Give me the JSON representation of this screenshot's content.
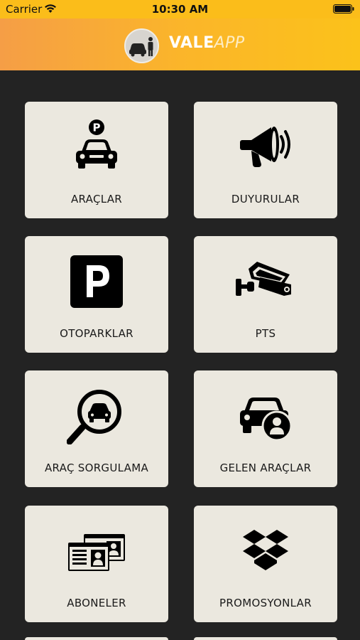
{
  "status_bar": {
    "carrier": "Carrier",
    "time": "10:30 AM"
  },
  "app": {
    "logo_main": "VALE",
    "logo_accent": "APP"
  },
  "menu": [
    {
      "label": "ARAÇLAR"
    },
    {
      "label": "DUYURULAR"
    },
    {
      "label": "OTOPARKLAR"
    },
    {
      "label": "PTS"
    },
    {
      "label": "ARAÇ SORGULAMA"
    },
    {
      "label": "GELEN ARAÇLAR"
    },
    {
      "label": "ABONELER"
    },
    {
      "label": "PROMOSYONLAR"
    }
  ],
  "colors": {
    "header_start": "#f59e46",
    "header_end": "#fbc21a",
    "background": "#232323",
    "tile": "#ebe8df"
  },
  "icons": [
    "parking-car-icon",
    "megaphone-icon",
    "parking-sign-icon",
    "camera-icon",
    "car-search-icon",
    "car-person-icon",
    "id-cards-icon",
    "dropbox-icon"
  ]
}
